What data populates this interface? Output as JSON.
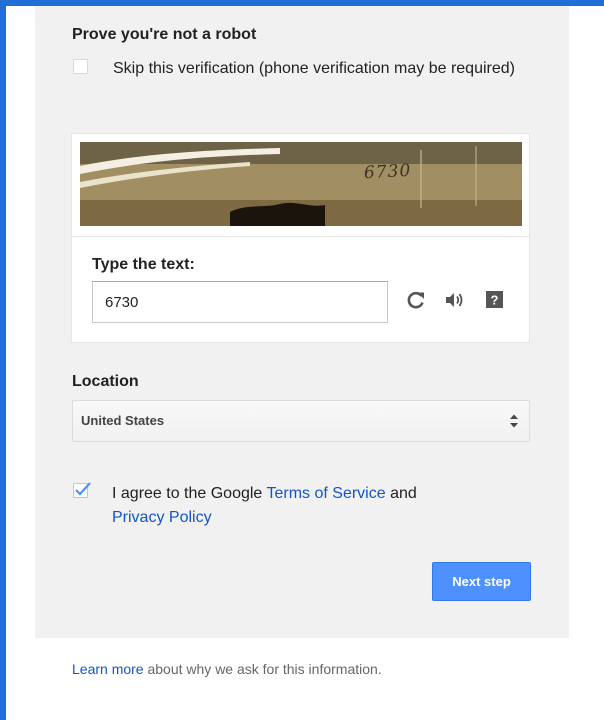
{
  "colors": {
    "frame": "#1f6fd6",
    "panel_background": "#f1f1f1",
    "link": "#1155cc",
    "primary_button": "#4d90fe"
  },
  "verification": {
    "heading": "Prove you're not a robot",
    "skip_label": "Skip this verification (phone verification may be required)",
    "skip_checked": false
  },
  "captcha": {
    "image_text": "6730",
    "type_label": "Type the text:",
    "input_value": "6730",
    "icons": [
      "refresh-icon",
      "audio-icon",
      "help-icon"
    ]
  },
  "location": {
    "label": "Location",
    "selected": "United States"
  },
  "terms": {
    "checked": true,
    "prefix": "I agree to the Google ",
    "terms_link": "Terms of Service",
    "middle": " and ",
    "privacy_link": "Privacy Policy"
  },
  "next_button": {
    "label": "Next step"
  },
  "footer": {
    "learn_more_link": "Learn more",
    "learn_more_text": " about why we ask for this information."
  }
}
